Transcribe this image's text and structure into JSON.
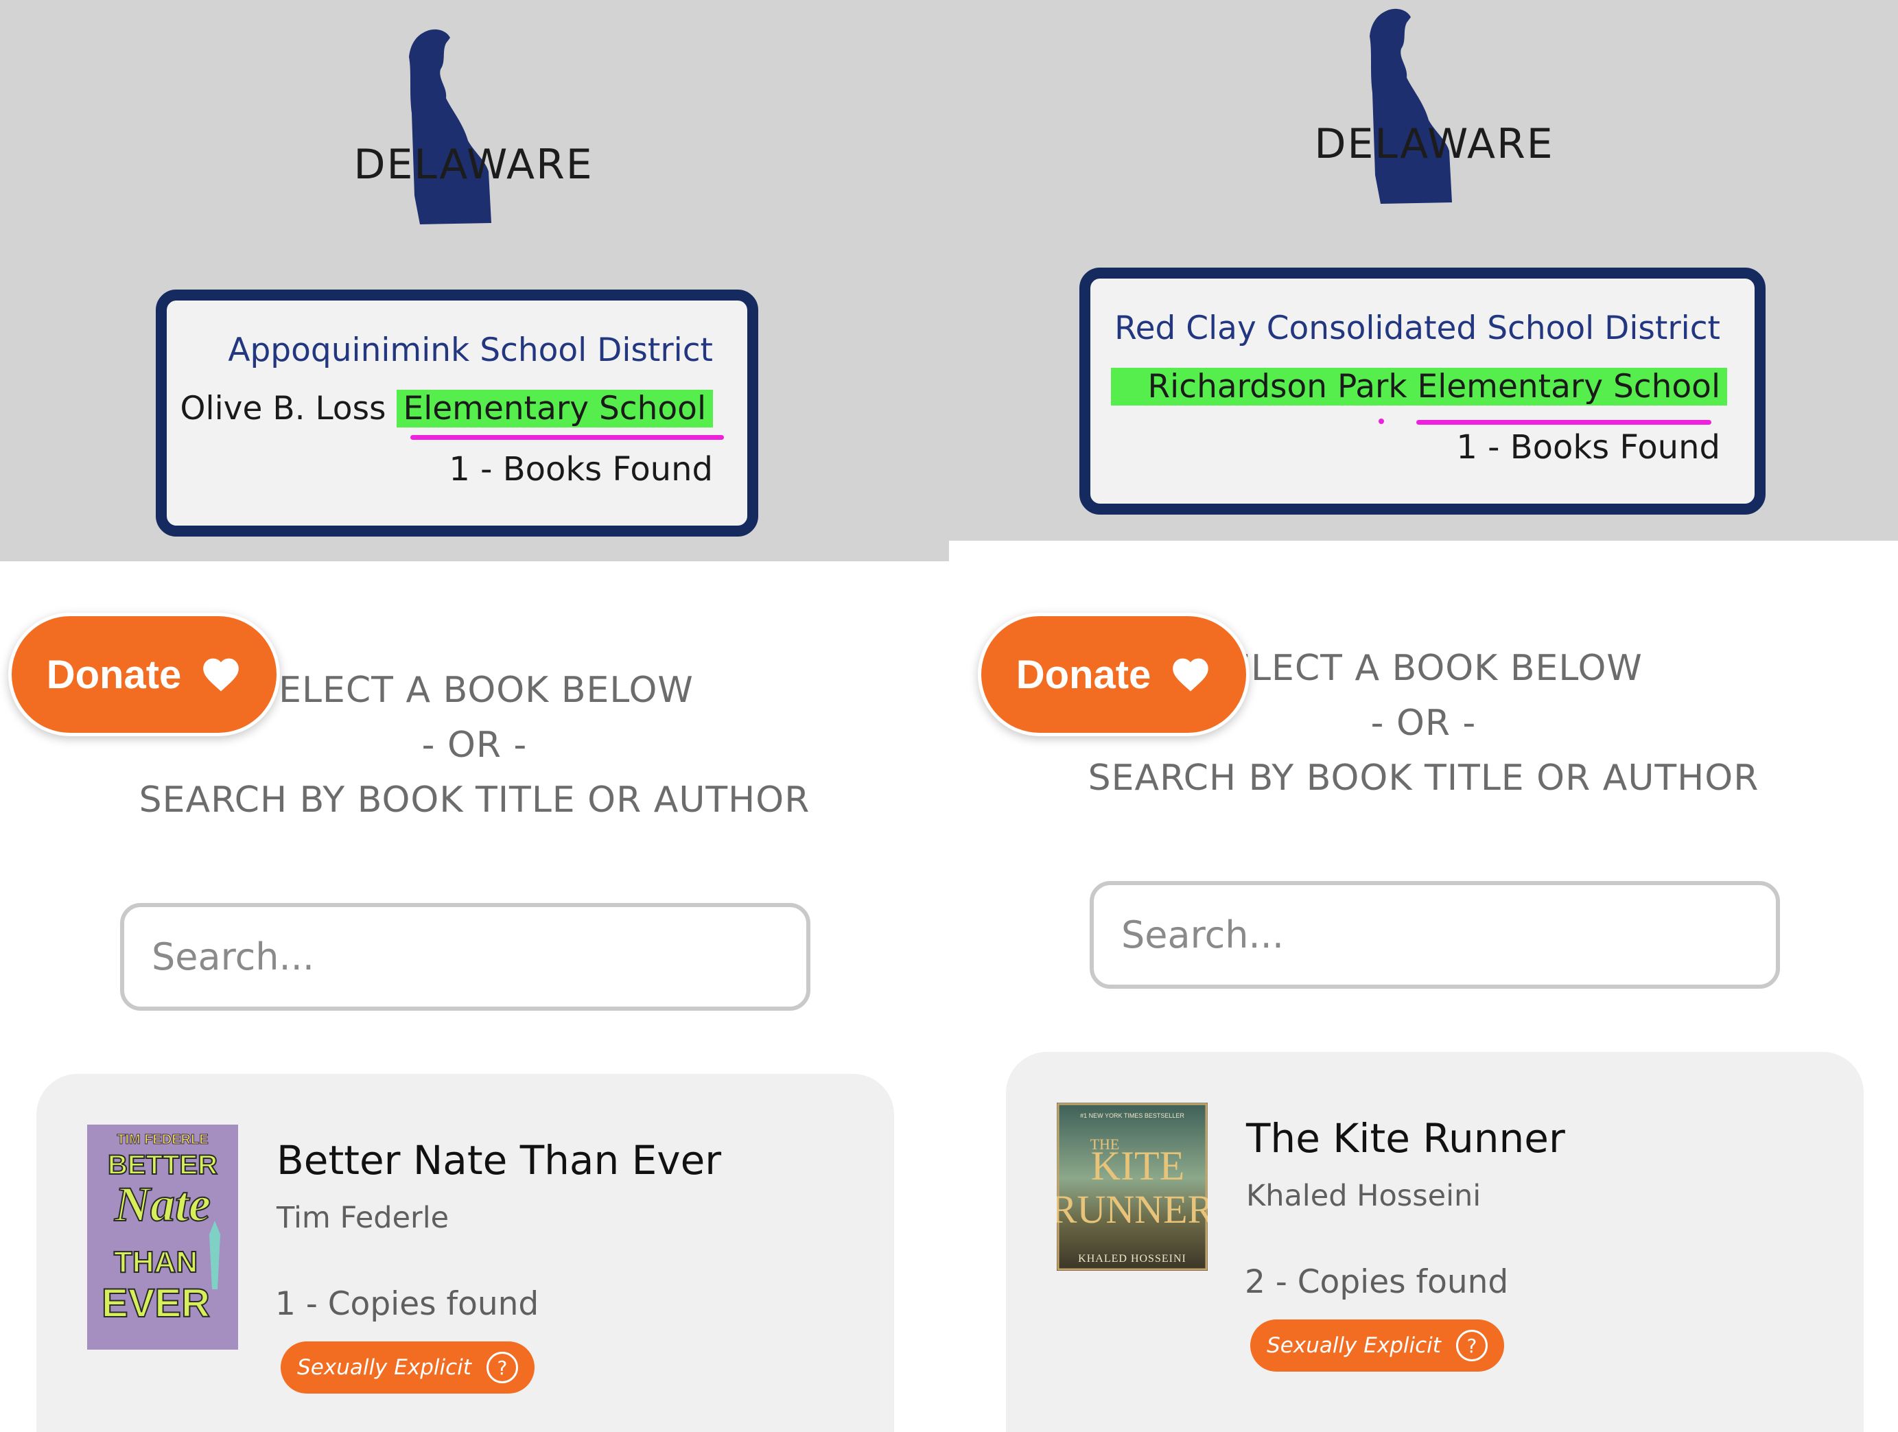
{
  "panels": {
    "left": {
      "state_label": "DELAWARE",
      "district": "Appoquinimink School District",
      "school_prefix": "Olive B. Loss",
      "school_highlight": "Elementary School",
      "books_found": "1 - Books Found",
      "donate_label": "Donate",
      "instruction": {
        "line1": "SELECT A BOOK BELOW",
        "line2": "- OR -",
        "line3": "SEARCH BY BOOK TITLE OR AUTHOR"
      },
      "search_placeholder": "Search...",
      "book": {
        "title": "Better Nate Than Ever",
        "author": "Tim Federle",
        "copies": "1 - Copies found",
        "tag": "Sexually Explicit",
        "tag_help": "?",
        "cover": {
          "top_text": "TIM FEDERLE",
          "line1": "BETTER",
          "line2": "Nate",
          "line3": "THAN",
          "line4": "EVER"
        }
      }
    },
    "right": {
      "state_label": "DELAWARE",
      "district": "Red Clay Consolidated School District",
      "school_prefix": "Richardson Park",
      "school_highlight": "Elementary School",
      "books_found": "1 - Books Found",
      "donate_label": "Donate",
      "instruction": {
        "line1": "SELECT A BOOK BELOW",
        "line2": "- OR -",
        "line3": "SEARCH BY BOOK TITLE OR AUTHOR"
      },
      "search_placeholder": "Search...",
      "book": {
        "title": "The Kite Runner",
        "author": "Khaled Hosseini",
        "copies": "2 - Copies found",
        "tag": "Sexually Explicit",
        "tag_help": "?",
        "cover": {
          "top_text": "#1 NEW YORK TIMES BESTSELLER",
          "line1": "THE",
          "line2": "KITE",
          "line3": "RUNNER",
          "line4": "KHALED HOSSEINI"
        }
      }
    }
  },
  "colors": {
    "header_bg": "#d3d3d3",
    "card_border": "#152a5e",
    "district_text": "#233781",
    "highlight": "#56ee4d",
    "underline": "#ee22dd",
    "accent_orange": "#f26d21",
    "state_silhouette": "#1d2f6e"
  }
}
